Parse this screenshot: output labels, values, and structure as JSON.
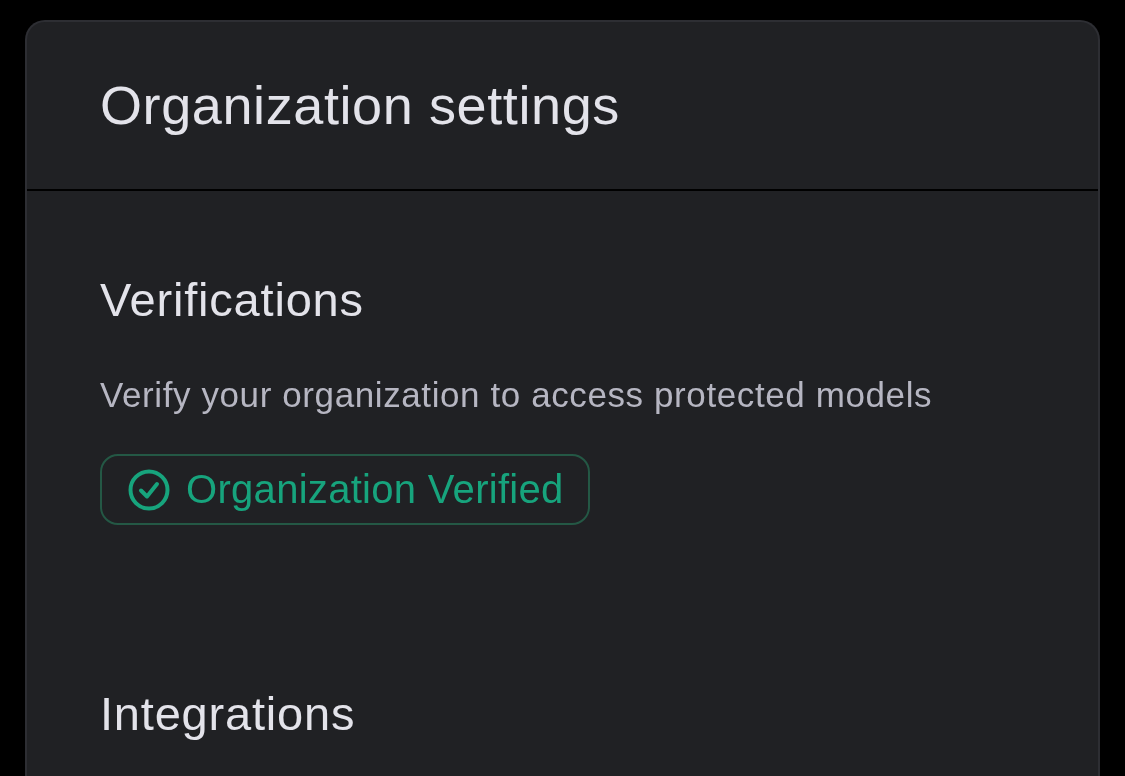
{
  "card": {
    "title": "Organization settings"
  },
  "sections": [
    {
      "kind": "verification",
      "heading": "Verifications",
      "description": "Verify your organization to access protected models",
      "badge": {
        "label": "Organization Verified"
      }
    },
    {
      "kind": "integrations",
      "heading": "Integrations"
    }
  ]
}
